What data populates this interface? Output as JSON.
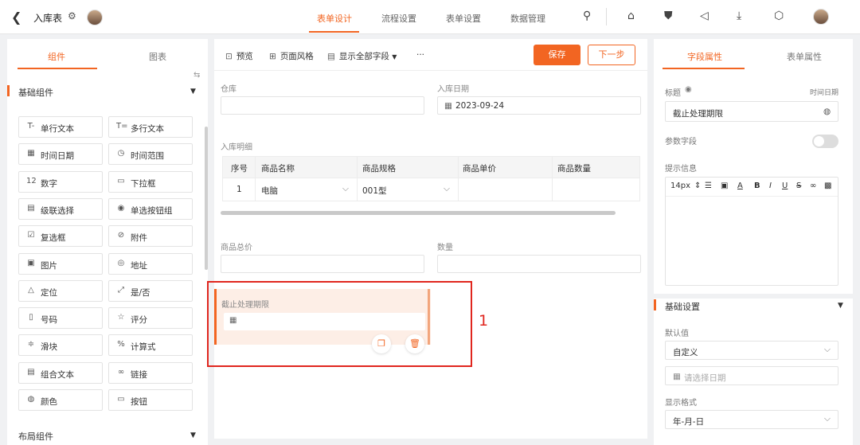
{
  "header": {
    "back_icon": "chevron-left-icon",
    "title": "入库表",
    "tabs": [
      {
        "label": "表单设计",
        "active": true
      },
      {
        "label": "流程设置",
        "active": false
      },
      {
        "label": "表单设置",
        "active": false
      },
      {
        "label": "数据管理",
        "active": false
      }
    ],
    "icons": [
      "search-icon",
      "home-icon",
      "shirt-icon",
      "megaphone-icon",
      "download-icon",
      "hexagon-icon"
    ]
  },
  "left_panel": {
    "tabs": [
      {
        "label": "组件",
        "active": true
      },
      {
        "label": "图表",
        "active": false
      }
    ],
    "basic_section": "基础组件",
    "components": [
      {
        "label": "单行文本",
        "icon": "T-"
      },
      {
        "label": "多行文本",
        "icon": "T="
      },
      {
        "label": "时间日期",
        "icon": "▦"
      },
      {
        "label": "时间范围",
        "icon": "◷"
      },
      {
        "label": "数字",
        "icon": "12"
      },
      {
        "label": "下拉框",
        "icon": "▭"
      },
      {
        "label": "级联选择",
        "icon": "▤"
      },
      {
        "label": "单选按钮组",
        "icon": "◉"
      },
      {
        "label": "复选框",
        "icon": "☑"
      },
      {
        "label": "附件",
        "icon": "⊘"
      },
      {
        "label": "图片",
        "icon": "▣"
      },
      {
        "label": "地址",
        "icon": "◎"
      },
      {
        "label": "定位",
        "icon": "△"
      },
      {
        "label": "是/否",
        "icon": "⤢"
      },
      {
        "label": "号码",
        "icon": "▯"
      },
      {
        "label": "评分",
        "icon": "☆"
      },
      {
        "label": "滑块",
        "icon": "≑"
      },
      {
        "label": "计算式",
        "icon": "%"
      },
      {
        "label": "组合文本",
        "icon": "▤"
      },
      {
        "label": "链接",
        "icon": "∞"
      },
      {
        "label": "颜色",
        "icon": "◍"
      },
      {
        "label": "按钮",
        "icon": "▭"
      }
    ],
    "layout_section": "布局组件"
  },
  "toolbar": {
    "preview": "预览",
    "page_style": "页面风格",
    "show_all": "显示全部字段",
    "more": "···",
    "save": "保存",
    "next": "下一步"
  },
  "form": {
    "warehouse_label": "仓库",
    "warehouse_value": "",
    "date_label": "入库日期",
    "date_value": "2023-09-24",
    "detail_label": "入库明细",
    "table": {
      "headers": [
        "序号",
        "商品名称",
        "商品规格",
        "商品单价",
        "商品数量"
      ],
      "rows": [
        [
          "1",
          "电脑",
          "001型",
          "",
          ""
        ]
      ]
    },
    "total_label": "商品总价",
    "qty_label": "数量",
    "deadline_label": "截止处理期限",
    "annotation": "1"
  },
  "right_panel": {
    "tabs": [
      {
        "label": "字段属性",
        "active": true
      },
      {
        "label": "表单属性",
        "active": false
      }
    ],
    "title_label": "标题",
    "field_type": "时间日期",
    "title_value": "截止处理期限",
    "param_label": "参数字段",
    "hint_label": "提示信息",
    "font_size": "14px",
    "basic_section": "基础设置",
    "default_label": "默认值",
    "default_value": "自定义",
    "date_placeholder": "请选择日期",
    "format_label": "显示格式",
    "format_value": "年-月-日"
  }
}
